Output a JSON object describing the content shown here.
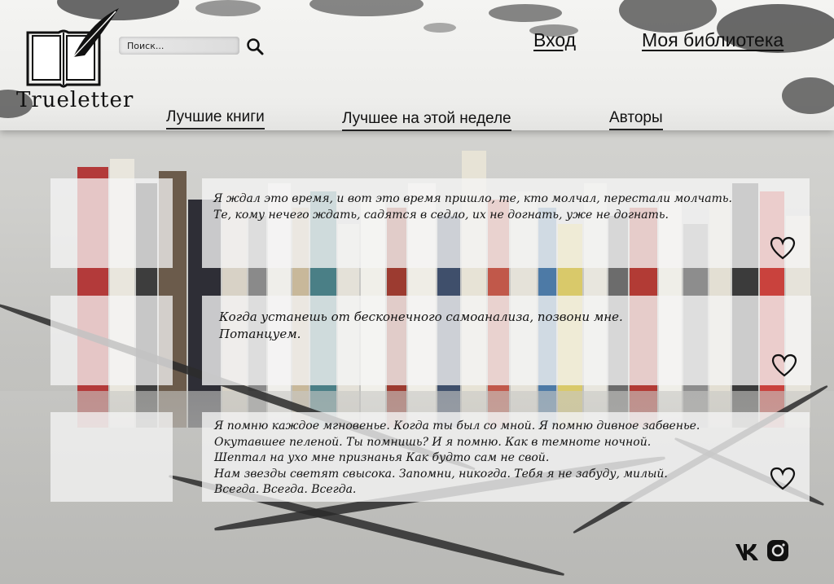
{
  "brand": {
    "name": "Trueletter"
  },
  "search": {
    "placeholder": "Поиск..."
  },
  "header_links": {
    "login": "Вход",
    "library": "Моя библиотека"
  },
  "nav": [
    {
      "label": "Лучшие книги"
    },
    {
      "label": "Лучшее на этой неделе"
    },
    {
      "label": "Авторы"
    }
  ],
  "quotes": [
    {
      "text": "Я ждал это время, и вот это время пришло, те, кто молчал, перестали молчать.\nТе, кому нечего ждать, садятся в седло, их не догнать, уже не догнать."
    },
    {
      "text": "Когда устанешь от бесконечного самоанализа, позвони мне.\nПотанцуем."
    },
    {
      "text": "Я помню каждое мгновенье. Когда ты был со мной. Я помню дивное забвенье.\nОкутавшее пеленой. Ты помнишь? И я помню. Как в темноте ночной.\nШептал на ухо мне признанья Как будто сам не свой.\nНам звезды светят свысока. Запомни, никогда. Тебя я не забуду, милый.\nВсегда. Всегда. Всегда."
    }
  ],
  "icons": {
    "like": "heart-icon",
    "search": "magnifier-icon",
    "social": [
      "vk-icon",
      "instagram-icon"
    ]
  },
  "colors": {
    "text": "#111111",
    "header_bg": "#f0f0ee",
    "card_bg": "#f5f5f5"
  }
}
